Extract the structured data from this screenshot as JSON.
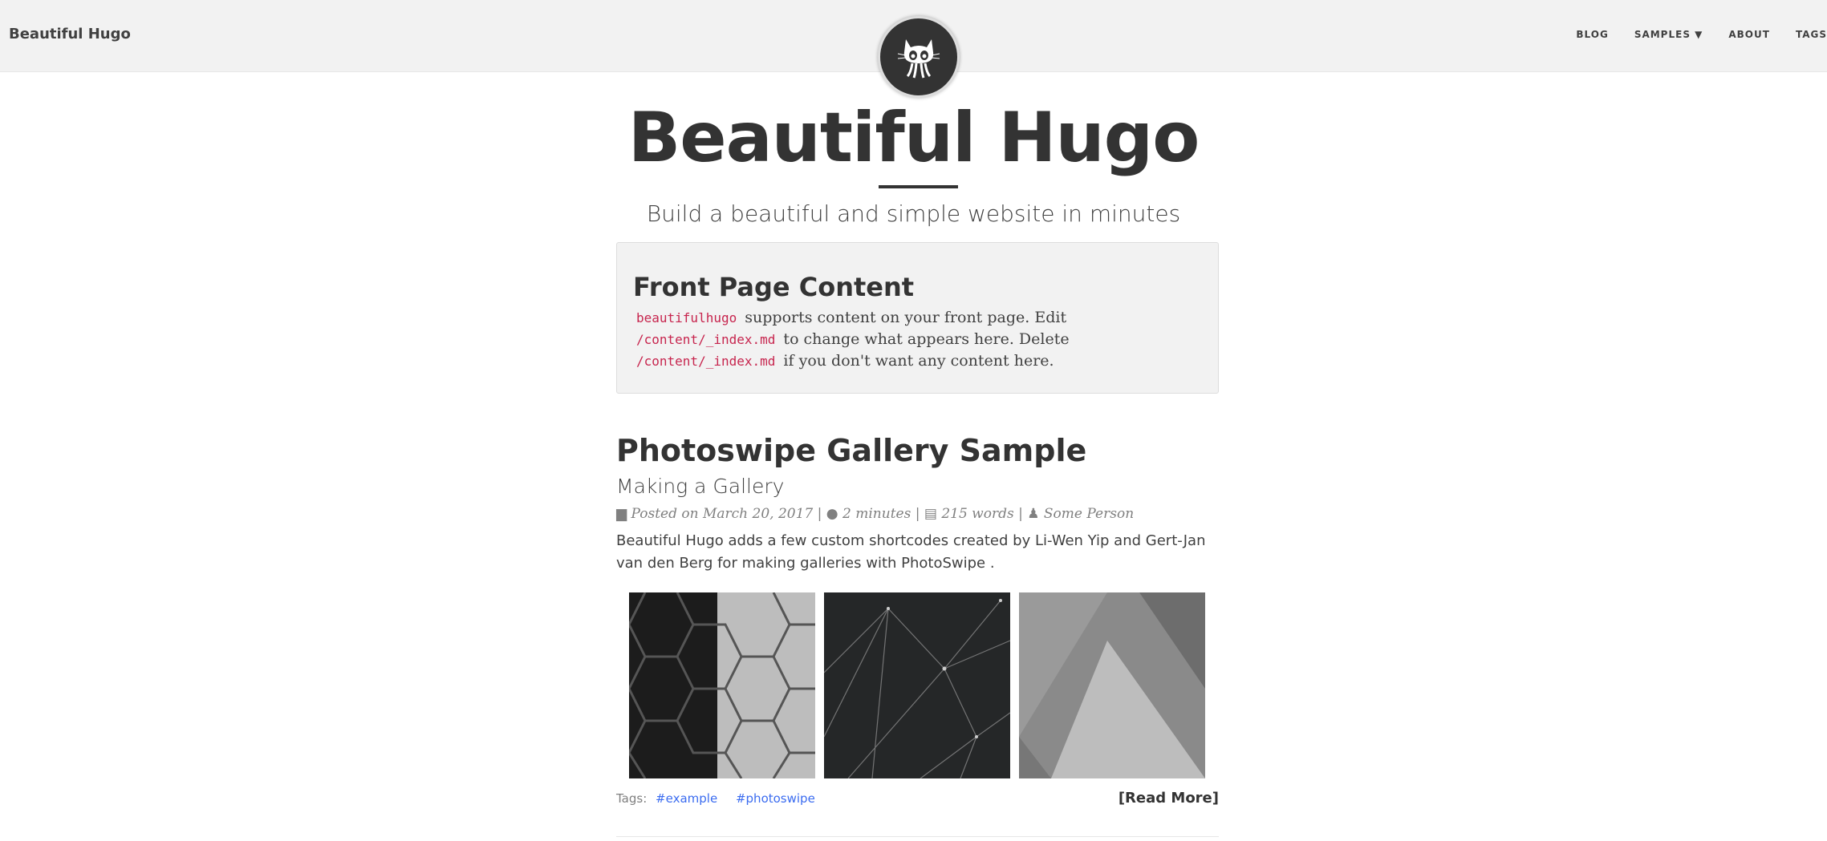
{
  "nav": {
    "brand": "Beautiful Hugo",
    "links": [
      "BLOG",
      "SAMPLES ▼",
      "ABOUT",
      "TAGS"
    ]
  },
  "header": {
    "title": "Beautiful Hugo",
    "subtitle": "Build a beautiful and simple website in minutes"
  },
  "front": {
    "heading": "Front Page Content",
    "code1": "beautifulhugo",
    "text1": " supports content on your front page. Edit ",
    "code2": "/content/_index.md",
    "text2": " to change what appears here. Delete ",
    "code3": "/content/_index.md",
    "text3": " if you don't want any content here."
  },
  "post": {
    "title": "Photoswipe Gallery Sample",
    "subtitle": "Making a Gallery",
    "date": "Posted on March 20, 2017",
    "reading_time": "2 minutes",
    "words": "215 words",
    "author": "Some Person",
    "excerpt": "Beautiful Hugo adds a few custom shortcodes created by Li-Wen Yip and Gert-Jan van den Berg for making galleries with PhotoSwipe .",
    "tags_label": "Tags:",
    "tags": [
      "#example",
      "#photoswipe"
    ],
    "read_more": "[Read More]"
  }
}
